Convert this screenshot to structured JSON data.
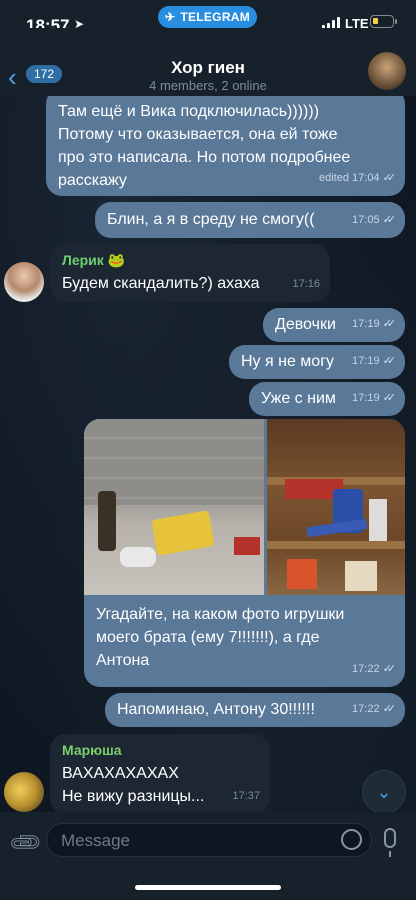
{
  "status_bar": {
    "time": "18:57",
    "pill": "TELEGRAM",
    "network": "LTE"
  },
  "header": {
    "back_count": "172",
    "title": "Хор гиен",
    "subtitle": "4 members, 2 online"
  },
  "messages": [
    {
      "type": "outgoing",
      "lines": [
        "Там ещё и Вика подключилась))))))",
        "Потому что оказывается, она ей тоже",
        "про это написала. Но потом подробнее",
        "расскажу"
      ],
      "time": "edited 17:04"
    },
    {
      "type": "outgoing",
      "text": "Блин, а я в среду не смогу((",
      "time": "17:05"
    },
    {
      "type": "incoming",
      "sender": "Лерик 🐸",
      "text": "Будем скандалить?) ахаха",
      "time": "17:16"
    },
    {
      "type": "outgoing",
      "text": "Девочки",
      "time": "17:19"
    },
    {
      "type": "outgoing",
      "text": "Ну я не могу",
      "time": "17:19"
    },
    {
      "type": "outgoing",
      "text": "Уже с ним",
      "time": "17:19"
    },
    {
      "type": "outgoing_photo",
      "lines": [
        "Угадайте, на каком фото игрушки",
        "моего брата (ему 7!!!!!!!), а где",
        "Антона"
      ],
      "time": "17:22"
    },
    {
      "type": "outgoing",
      "text": "Напоминаю, Антону 30!!!!!!",
      "time": "17:22"
    },
    {
      "type": "incoming",
      "sender": "Марюша",
      "lines": [
        "ВАХАХАХАХАХ",
        "Не вижу разницы..."
      ],
      "time": "17:37"
    }
  ],
  "input": {
    "placeholder": "Message"
  },
  "icons": [
    "back-chevron-icon",
    "attach-icon",
    "sticker-icon",
    "microphone-icon",
    "scroll-down-icon",
    "read-checkmarks-icon"
  ],
  "colors": {
    "background": "#0e1621",
    "outgoing_bubble": "#5a7898",
    "incoming_bubble": "#1c2733",
    "accent": "#4fa3e8",
    "sender_green": "#6fd06f"
  }
}
